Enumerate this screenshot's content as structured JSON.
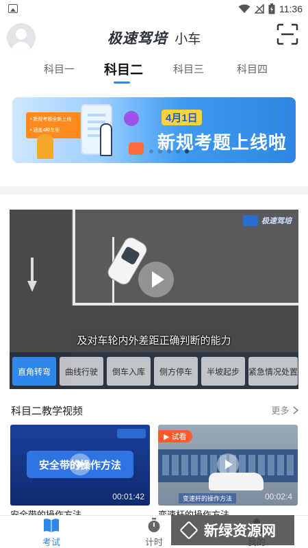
{
  "status_bar": {
    "time": "11:36"
  },
  "header": {
    "brand_logo": "极速驾培",
    "vehicle_type": "小车"
  },
  "tabs": [
    {
      "label": "科目一"
    },
    {
      "label": "科目二"
    },
    {
      "label": "科目三"
    },
    {
      "label": "科目四"
    }
  ],
  "active_tab": "科目二",
  "banner": {
    "date": "4月1日",
    "title": "新规考题上线啦",
    "chip_lines": [
      "• 新规考题全新上线",
      "• 涵盖4种车型"
    ],
    "slides": 5,
    "active_slide": 5
  },
  "video": {
    "subtitle": "及对车轮内外差距正确判断的能力",
    "categories": [
      "直角转弯",
      "曲线行驶",
      "倒车入库",
      "侧方停车",
      "半坡起步",
      "紧急情况处置"
    ],
    "active_category": "直角转弯"
  },
  "section": {
    "title": "科目二教学视频",
    "more": "更多"
  },
  "thumbnails": [
    {
      "overlay_text": "安全带的操作方法",
      "duration": "00:01:42",
      "label": "安全带的操作方法"
    },
    {
      "badge": "试看",
      "caption": "变速杆的操作方法",
      "duration": "00:02:4",
      "label": "变速杆的操作方法"
    }
  ],
  "bottom_nav": [
    {
      "label": "考试"
    },
    {
      "label": "计时"
    },
    {
      "label": "我的"
    }
  ],
  "watermark": {
    "text": "新绿资源网"
  },
  "colors": {
    "accent": "#2f88e8",
    "banner_accent": "#ffd23a"
  }
}
